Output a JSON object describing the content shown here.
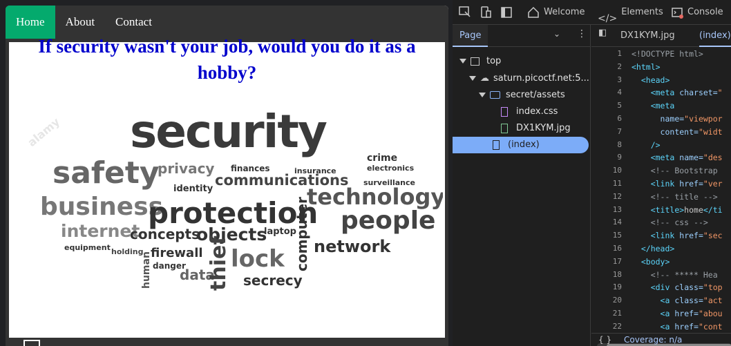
{
  "page": {
    "nav": [
      {
        "label": "Home",
        "active": true
      },
      {
        "label": "About",
        "active": false
      },
      {
        "label": "Contact",
        "active": false
      }
    ],
    "headline": "If security wasn't your job, would you do it as a hobby?",
    "cloud_words": {
      "security": "security",
      "safety": "safety",
      "privacy": "privacy",
      "business": "business",
      "protection": "protection",
      "technology": "technology",
      "people": "people",
      "internet": "internet",
      "concepts": "concepts",
      "objects": "objects",
      "lock": "lock",
      "network": "network",
      "computer": "computer",
      "communications": "communications",
      "thief": "thief",
      "secrecy": "secrecy",
      "firewall": "firewall",
      "identity": "identity",
      "finances": "finances",
      "insurance": "insurance",
      "crime": "crime",
      "electronics": "electronics",
      "surveillance": "surveillance",
      "data": "data",
      "human": "human",
      "laptop": "laptop",
      "equipment": "equipment",
      "holding": "holding",
      "danger": "danger",
      "watermark": "alamy"
    }
  },
  "devtools": {
    "tabs": {
      "welcome": "Welcome",
      "elements": "Elements",
      "console": "Console"
    },
    "nav_pane": {
      "tab": "Page",
      "tree": [
        {
          "label": "top",
          "kind": "frame"
        },
        {
          "label": "saturn.picoctf.net:5...",
          "kind": "cloud"
        },
        {
          "label": "secret/assets",
          "kind": "folder"
        },
        {
          "label": "index.css",
          "kind": "css"
        },
        {
          "label": "DX1KYM.jpg",
          "kind": "image"
        },
        {
          "label": "(index)",
          "kind": "doc"
        }
      ]
    },
    "editor": {
      "tabs": [
        "DX1KYM.jpg",
        "(index)"
      ],
      "line_numbers": [
        "1",
        "2",
        "3",
        "4",
        "5",
        "6",
        "7",
        "8",
        "9",
        "10",
        "11",
        "12",
        "13",
        "14",
        "15",
        "16",
        "17",
        "18",
        "19",
        "20",
        "21",
        "22"
      ],
      "status": "Coverage: n/a",
      "braces": "{ }"
    }
  }
}
